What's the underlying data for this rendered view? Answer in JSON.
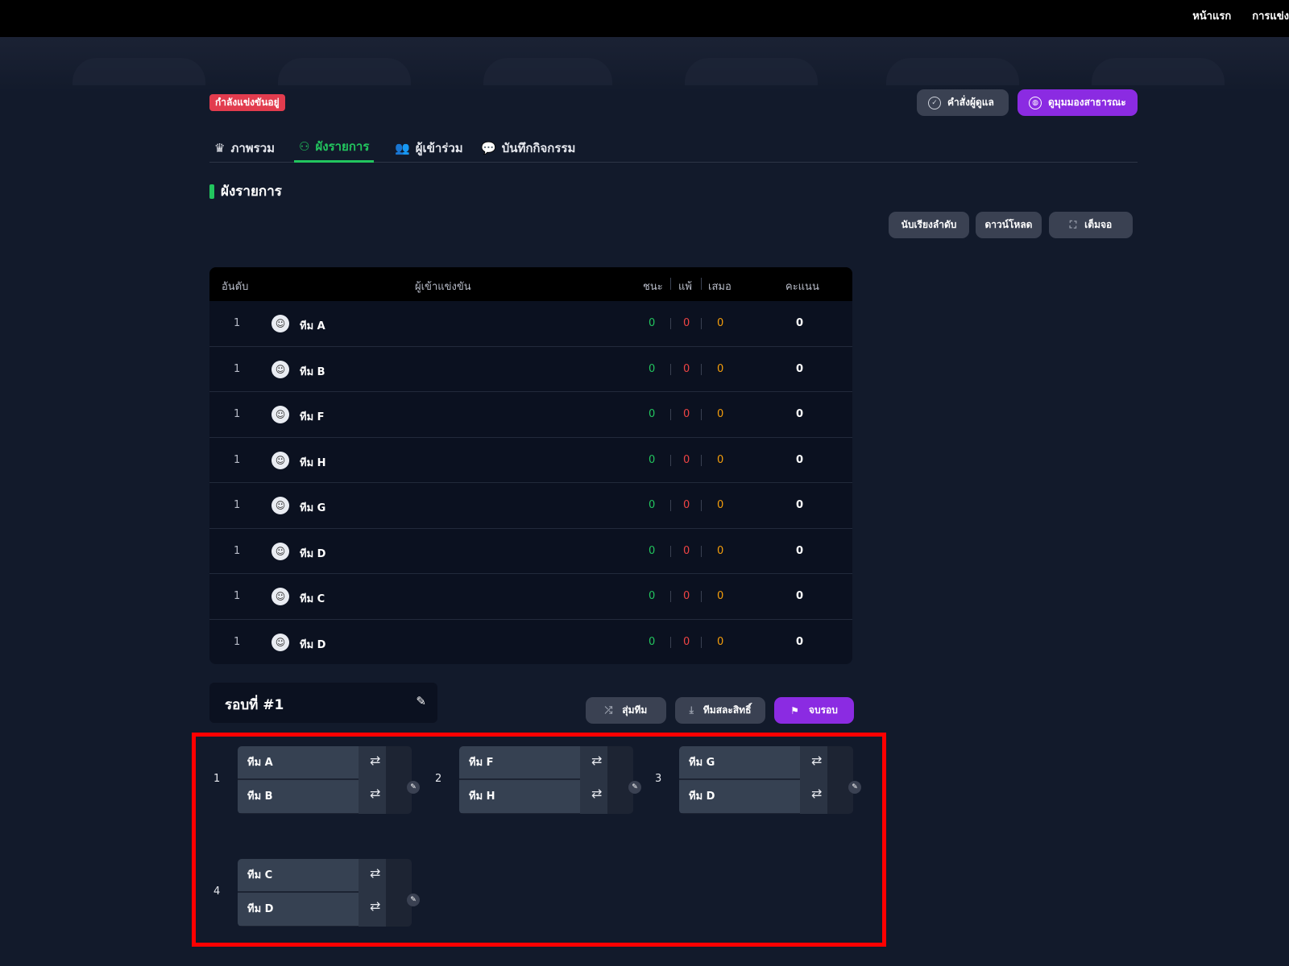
{
  "topnav": {
    "home": "หน้าแรก",
    "tournaments": "การแข่ง"
  },
  "status_badge": "กำลังแข่งขันอยู่",
  "header_buttons": {
    "admin": "คำสั่งผู้ดูแล",
    "public": "ดูมุมมองสาธารณะ"
  },
  "tabs": [
    {
      "label": "ภาพรวม",
      "icon": "crown-icon"
    },
    {
      "label": "ผังรายการ",
      "icon": "bracket-icon",
      "active": true
    },
    {
      "label": "ผู้เข้าร่วม",
      "icon": "users-icon"
    },
    {
      "label": "บันทึกกิจกรรม",
      "icon": "chat-icon"
    }
  ],
  "section_title": "ผังรายการ",
  "tools": {
    "sort": "นับเรียงลำดับ",
    "download": "ดาวน์โหลด",
    "fullscreen": "เต็มจอ"
  },
  "standings": {
    "headers": {
      "rank": "อันดับ",
      "participant": "ผู้เข้าแข่งขัน",
      "win": "ชนะ",
      "loss": "แพ้",
      "draw": "เสมอ",
      "points": "คะแนน"
    },
    "rows": [
      {
        "rank": "1",
        "team": "ทีม A",
        "win": "0",
        "loss": "0",
        "draw": "0",
        "points": "0"
      },
      {
        "rank": "1",
        "team": "ทีม B",
        "win": "0",
        "loss": "0",
        "draw": "0",
        "points": "0"
      },
      {
        "rank": "1",
        "team": "ทีม F",
        "win": "0",
        "loss": "0",
        "draw": "0",
        "points": "0"
      },
      {
        "rank": "1",
        "team": "ทีม H",
        "win": "0",
        "loss": "0",
        "draw": "0",
        "points": "0"
      },
      {
        "rank": "1",
        "team": "ทีม G",
        "win": "0",
        "loss": "0",
        "draw": "0",
        "points": "0"
      },
      {
        "rank": "1",
        "team": "ทีม D",
        "win": "0",
        "loss": "0",
        "draw": "0",
        "points": "0"
      },
      {
        "rank": "1",
        "team": "ทีม C",
        "win": "0",
        "loss": "0",
        "draw": "0",
        "points": "0"
      },
      {
        "rank": "1",
        "team": "ทีม D",
        "win": "0",
        "loss": "0",
        "draw": "0",
        "points": "0"
      }
    ]
  },
  "round": {
    "title": "รอบที่ #1"
  },
  "round_buttons": {
    "shuffle": "สุ่มทีม",
    "bye": "ทีมสละสิทธิ์",
    "end": "จบรอบ"
  },
  "matches": [
    {
      "num": "1",
      "team_a": "ทีม A",
      "team_b": "ทีม B"
    },
    {
      "num": "2",
      "team_a": "ทีม F",
      "team_b": "ทีม H"
    },
    {
      "num": "3",
      "team_a": "ทีม G",
      "team_b": "ทีม D"
    },
    {
      "num": "4",
      "team_a": "ทีม C",
      "team_b": "ทีม D"
    }
  ],
  "colors": {
    "accent_green": "#22c55e",
    "accent_purple": "#8b2be2",
    "badge_red": "#e23c4e",
    "highlight_red": "#ff0000"
  }
}
